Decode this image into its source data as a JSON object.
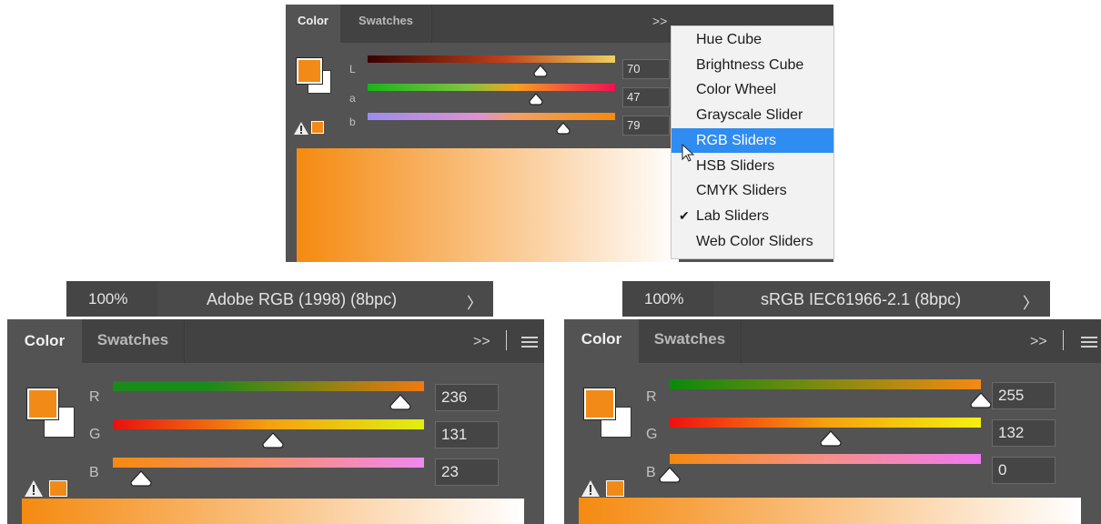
{
  "top_panel": {
    "tabs": [
      "Color",
      "Swatches"
    ],
    "menu_icons": ">>",
    "channels": [
      {
        "label": "L",
        "value": "70",
        "level": 0.7
      },
      {
        "label": "a",
        "value": "47",
        "level": 0.68
      },
      {
        "label": "b",
        "value": "79",
        "level": 0.79
      }
    ],
    "menu": {
      "items": [
        {
          "label": "Hue Cube",
          "highlighted": false,
          "checked": false
        },
        {
          "label": "Brightness Cube",
          "highlighted": false,
          "checked": false
        },
        {
          "label": "Color Wheel",
          "highlighted": false,
          "checked": false
        },
        {
          "label": "Grayscale Slider",
          "highlighted": false,
          "checked": false
        },
        {
          "label": "RGB Sliders",
          "highlighted": true,
          "checked": false
        },
        {
          "label": "HSB Sliders",
          "highlighted": false,
          "checked": false
        },
        {
          "label": "CMYK Sliders",
          "highlighted": false,
          "checked": false
        },
        {
          "label": "Lab Sliders",
          "highlighted": false,
          "checked": true
        },
        {
          "label": "Web Color Sliders",
          "highlighted": false,
          "checked": false
        }
      ],
      "check_glyph": "✔"
    }
  },
  "left_panel": {
    "status": {
      "zoom": "100%",
      "profile": "Adobe RGB (1998) (8bpc)",
      "arrow": "〉"
    },
    "tabs": [
      "Color",
      "Swatches"
    ],
    "menu_icons": ">>",
    "channels": [
      {
        "label": "R",
        "value": "236",
        "level": 0.925
      },
      {
        "label": "G",
        "value": "131",
        "level": 0.514
      },
      {
        "label": "B",
        "value": "23",
        "level": 0.09
      }
    ]
  },
  "right_panel": {
    "status": {
      "zoom": "100%",
      "profile": "sRGB IEC61966-2.1 (8bpc)",
      "arrow": "〉"
    },
    "tabs": [
      "Color",
      "Swatches"
    ],
    "menu_icons": ">>",
    "channels": [
      {
        "label": "R",
        "value": "255",
        "level": 1.0
      },
      {
        "label": "G",
        "value": "132",
        "level": 0.518
      },
      {
        "label": "B",
        "value": "0",
        "level": 0.0
      }
    ]
  },
  "colors": {
    "foreground": "#f28a17",
    "background": "#ffffff",
    "panel": "#535353",
    "tabbar": "#424242",
    "menu_highlight": "#2f8cf0"
  },
  "icons": {
    "warning": "warning-icon",
    "gamut_swatch": "gamut-swatch",
    "panel_menu": "hamburger-icon",
    "expand": "double-chevron-icon"
  }
}
